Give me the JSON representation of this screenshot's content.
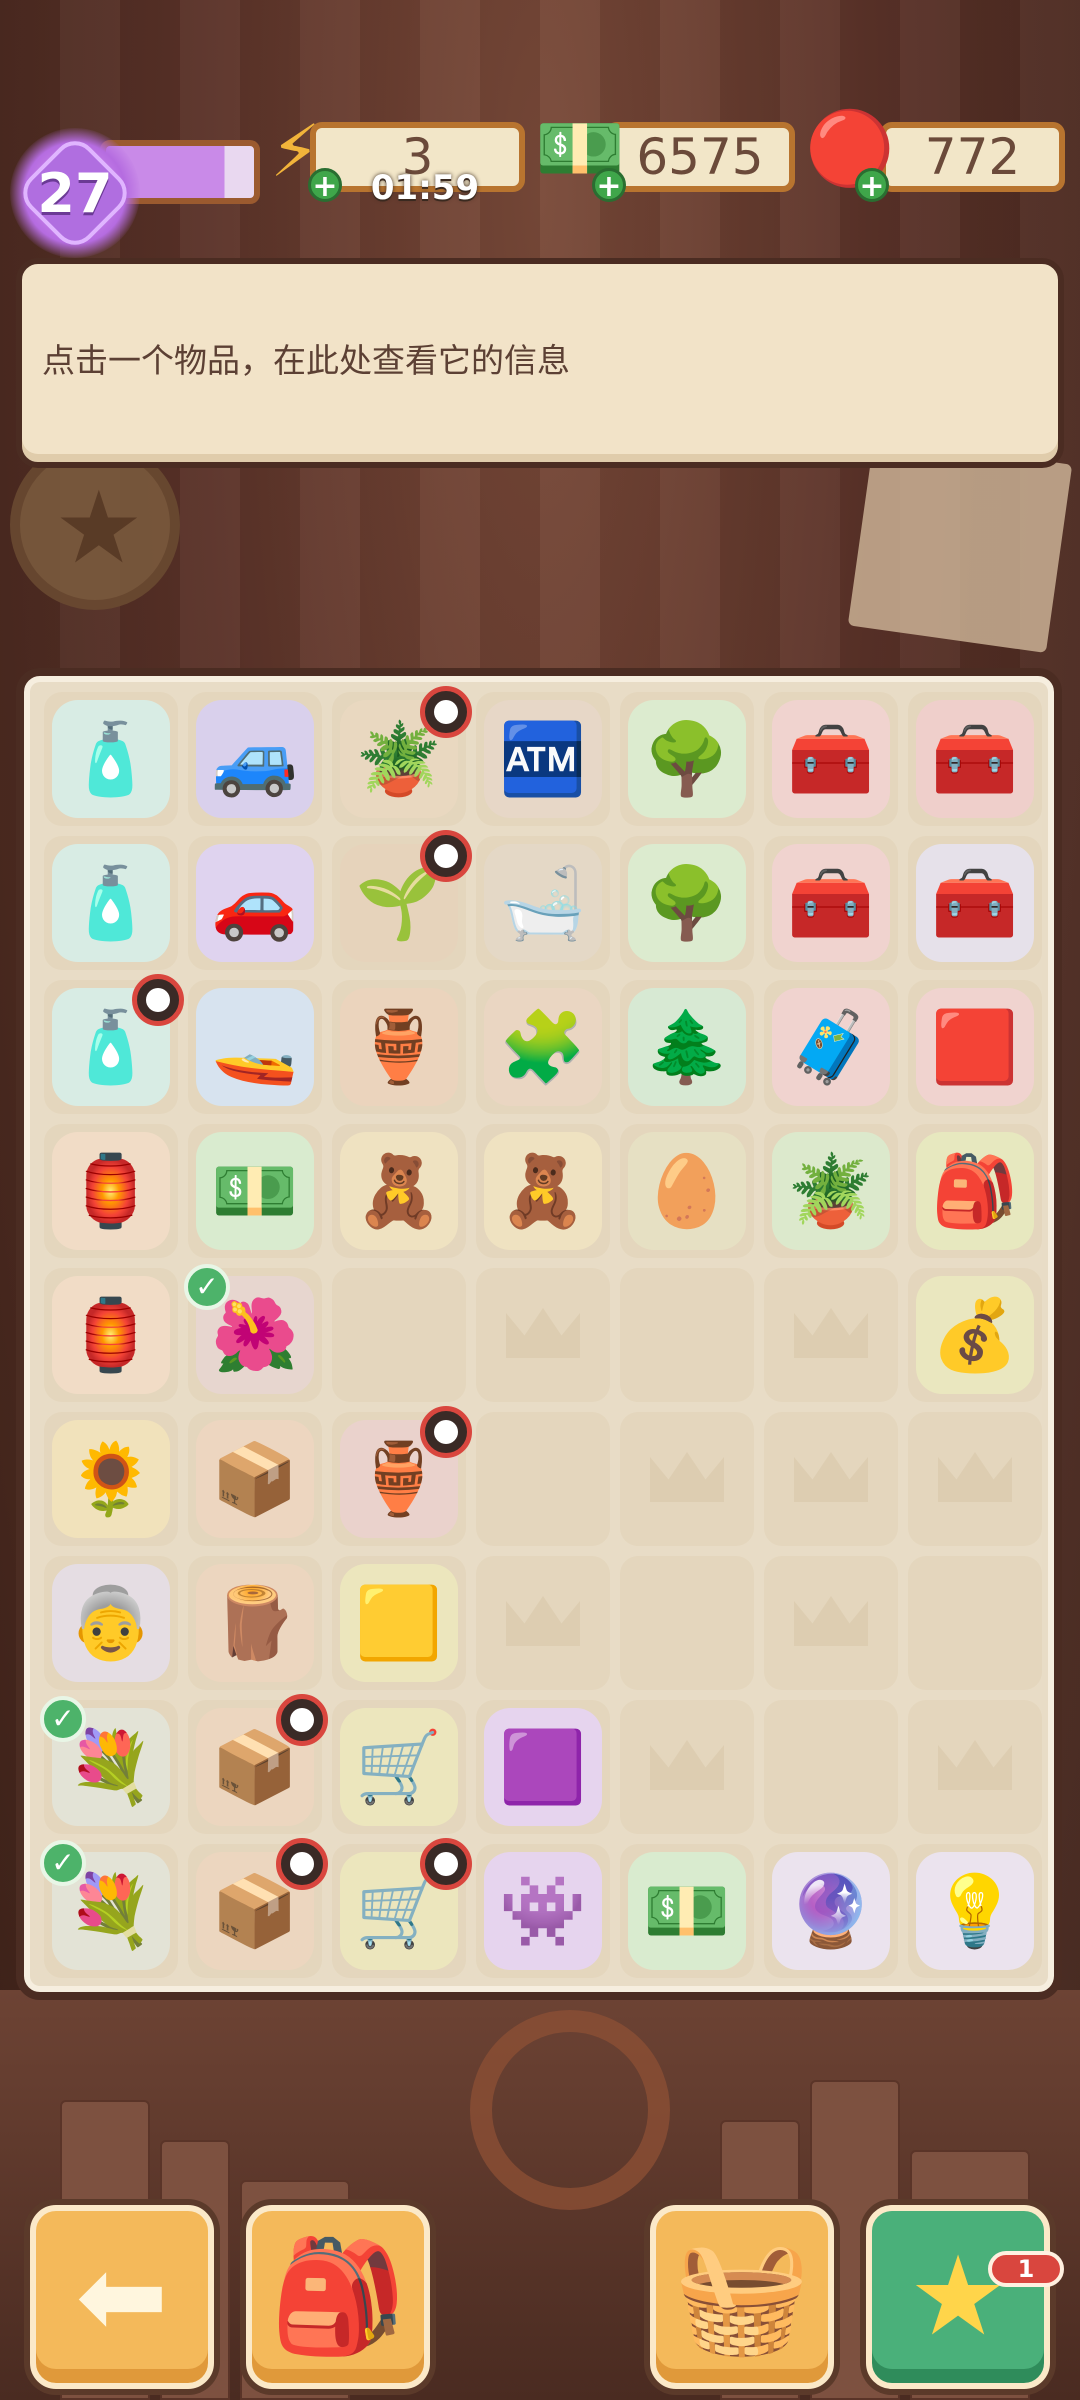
{
  "hud": {
    "level": "27",
    "level_progress": 0.8,
    "energy": "3",
    "energy_timer": "01:59",
    "cash": "6575",
    "gems": "772"
  },
  "info_panel": {
    "text": "点击一个物品，在此处查看它的信息"
  },
  "board": {
    "rows": [
      [
        {
          "name": "medical-supplies",
          "icon": "🧴"
        },
        {
          "name": "offroad-jeep",
          "icon": "🚙"
        },
        {
          "name": "herb-pot",
          "icon": "🪴",
          "timer": true
        },
        {
          "name": "vending-booth",
          "icon": "🏧"
        },
        {
          "name": "blossom-tree",
          "icon": "🌳"
        },
        {
          "name": "red-toolbox-open",
          "icon": "🧰"
        },
        {
          "name": "toolbox-full",
          "icon": "🧰"
        }
      ],
      [
        {
          "name": "medical-supplies",
          "icon": "🧴"
        },
        {
          "name": "purple-car",
          "icon": "🚗"
        },
        {
          "name": "sprout-pot",
          "icon": "🌱",
          "timer": true
        },
        {
          "name": "investigation-booth",
          "icon": "🛁"
        },
        {
          "name": "blossom-tree",
          "icon": "🌳"
        },
        {
          "name": "red-toolbox",
          "icon": "🧰"
        },
        {
          "name": "silver-toolbox",
          "icon": "🧰"
        }
      ],
      [
        {
          "name": "medical-supplies",
          "icon": "🧴",
          "timer": true
        },
        {
          "name": "jet-ski",
          "icon": "🚤"
        },
        {
          "name": "clay-pot",
          "icon": "🏺"
        },
        {
          "name": "puzzle-piece",
          "icon": "🧩"
        },
        {
          "name": "bonsai",
          "icon": "🌲"
        },
        {
          "name": "red-case",
          "icon": "🧳"
        },
        {
          "name": "tray",
          "icon": "🟥"
        }
      ],
      [
        {
          "name": "dragon-vase",
          "icon": "🏮"
        },
        {
          "name": "cash-pile",
          "icon": "💵"
        },
        {
          "name": "straw-doll",
          "icon": "🧸"
        },
        {
          "name": "straw-doll",
          "icon": "🧸"
        },
        {
          "name": "dino-egg",
          "icon": "🥚"
        },
        {
          "name": "potted-plant",
          "icon": "🪴"
        },
        {
          "name": "seed-pouch",
          "icon": "🎒"
        }
      ],
      [
        {
          "name": "dragon-vase",
          "icon": "🏮"
        },
        {
          "name": "flower-bed",
          "icon": "🌺",
          "check": true
        },
        {
          "name": "empty",
          "icon": ""
        },
        {
          "name": "empty",
          "icon": "",
          "crown": true
        },
        {
          "name": "empty",
          "icon": ""
        },
        {
          "name": "empty",
          "icon": "",
          "crown": true
        },
        {
          "name": "seed-bag",
          "icon": "💰"
        }
      ],
      [
        {
          "name": "sunflower-basket",
          "icon": "🌻"
        },
        {
          "name": "cardboard-box",
          "icon": "📦"
        },
        {
          "name": "jar",
          "icon": "🏺",
          "timer": true
        },
        {
          "name": "empty",
          "icon": ""
        },
        {
          "name": "empty",
          "icon": "",
          "crown": true
        },
        {
          "name": "empty",
          "icon": "",
          "crown": true
        },
        {
          "name": "empty",
          "icon": "",
          "crown": true
        }
      ],
      [
        {
          "name": "old-lady-character",
          "icon": "👵"
        },
        {
          "name": "pottery-crate",
          "icon": "🪵"
        },
        {
          "name": "gold-tray",
          "icon": "🟨"
        },
        {
          "name": "empty",
          "icon": "",
          "crown": true
        },
        {
          "name": "empty",
          "icon": ""
        },
        {
          "name": "empty",
          "icon": "",
          "crown": true
        },
        {
          "name": "empty",
          "icon": ""
        }
      ],
      [
        {
          "name": "flower-bouquet",
          "icon": "💐",
          "check": true
        },
        {
          "name": "wood-crate",
          "icon": "📦",
          "timer": true
        },
        {
          "name": "gold-cart",
          "icon": "🛒"
        },
        {
          "name": "purple-gem",
          "icon": "🟪"
        },
        {
          "name": "empty",
          "icon": "",
          "crown": true
        },
        {
          "name": "empty",
          "icon": ""
        },
        {
          "name": "empty",
          "icon": "",
          "crown": true
        }
      ],
      [
        {
          "name": "flower-bouquet",
          "icon": "💐",
          "check": true
        },
        {
          "name": "pottery-crate",
          "icon": "📦",
          "timer": true
        },
        {
          "name": "cart-full",
          "icon": "🛒",
          "timer": true
        },
        {
          "name": "purple-slime",
          "icon": "👾"
        },
        {
          "name": "cash-bundle",
          "icon": "💵"
        },
        {
          "name": "light-bulb-orb",
          "icon": "🔮"
        },
        {
          "name": "light-bulb-lamp",
          "icon": "💡"
        }
      ]
    ]
  },
  "bottom_bar": {
    "back_icon": "back-arrow-icon",
    "backpack_icon": "backpack-icon",
    "basket_icon": "basket-icon",
    "star_icon": "star-icon",
    "star_badge": "1"
  },
  "colors": {
    "board_bg": "#e8dcc6",
    "accent_orange": "#f4b95a",
    "accent_green": "#4ab07a",
    "level_purple": "#b06ee0"
  }
}
